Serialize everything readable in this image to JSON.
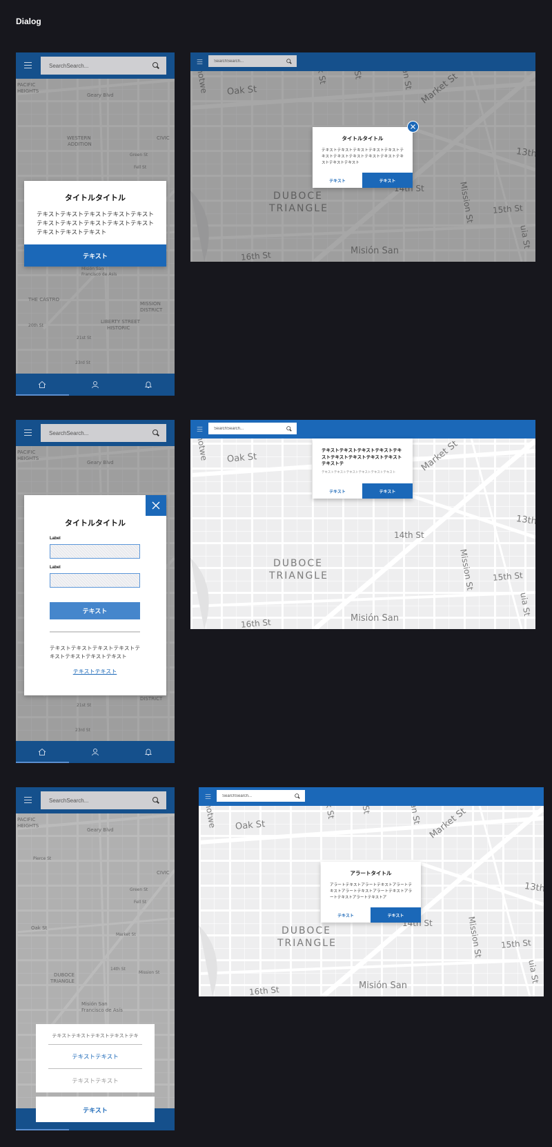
{
  "page": {
    "title": "Dialog"
  },
  "search": {
    "mobile_placeholder": "SearchSearch...",
    "desktop_placeholder": "SearchSearch...",
    "mobile_placeholder_3": "SearchSearch...",
    "desktop_placeholder_3": "SearchSearch..."
  },
  "map": {
    "labels": [
      "Oak St",
      "Market St",
      "DUBOCE",
      "TRIANGLE",
      "14th St",
      "15th St",
      "Mission St",
      "13th",
      "16th St",
      "Misión San",
      "Shotwe",
      "rick St",
      "e St",
      "nanan St",
      "uia St"
    ],
    "mobile_labels": [
      "Geary Blvd",
      "WESTERN",
      "ADDITION",
      "Fell St",
      "THE CASTRO",
      "MISSION",
      "DISTRICT",
      "LIBERTY STREET",
      "HISTORIC",
      "20th St",
      "21st St",
      "23rd St",
      "Oak St",
      "DUBOCE",
      "TRIANGLE",
      "14th St",
      "Mission St",
      "Misión San",
      "Francisco de Asís",
      "Market St",
      "Pierce St",
      "Green St",
      "CIVIC",
      "PACIFIC",
      "HEIGHTS"
    ]
  },
  "dialog1": {
    "title": "タイトルタイトル",
    "body": "テキストテキストテキストテキストテキストテキストテキストテキストテキストテキストテキストテキストテキスト",
    "button": "テキスト"
  },
  "dialog2": {
    "title": "タイトルタイトル",
    "body": "テキストテキストテキストテキストテキストテキストテキストテキストテキストテキストテキストテキストテキスト",
    "secondary_button": "テキスト",
    "primary_button": "テキスト"
  },
  "dialog3": {
    "title": "タイトルタイトル",
    "label1": "Label",
    "label2": "Label",
    "submit": "テキスト",
    "body": "テキストテキストテキストテキストテキストテキストテキストテキスト",
    "link": "テキストテキスト"
  },
  "dialog4": {
    "title": "テキストテキストテキストテキストテキストテキストテキストテキストテキストテキストテ",
    "body": "テキストテキストテキストテキストテキストテキスト",
    "secondary_button": "テキスト",
    "primary_button": "テキスト"
  },
  "sheet": {
    "header": "テキストテキストテキストテキストテキ",
    "action1": "テキストテキスト",
    "action2": "テキストテキスト",
    "cancel": "テキスト"
  },
  "alert": {
    "title": "アラートタイトル",
    "body": "アラートテキストアラートテキストアラートテキストアラートテキストアラートテキストアラートテキストアラートテキストア",
    "secondary_button": "テキスト",
    "primary_button": "テキスト"
  },
  "colors": {
    "brand": "#1b68b8",
    "brand_dark": "#15508c",
    "background": "#17171d"
  }
}
